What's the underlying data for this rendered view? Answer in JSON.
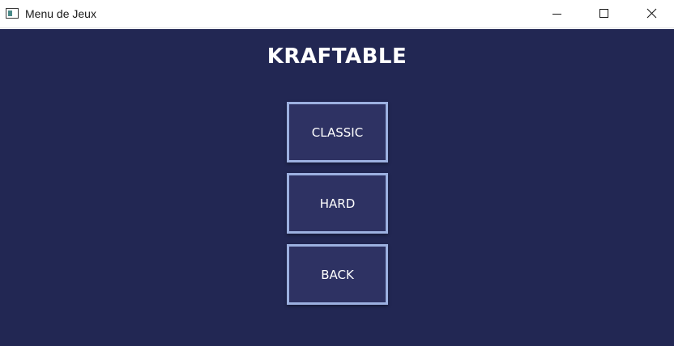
{
  "window": {
    "title": "Menu de Jeux",
    "icon": "app-window-icon",
    "controls": {
      "minimize_icon": "minimize-icon",
      "maximize_icon": "maximize-icon",
      "close_icon": "close-icon"
    }
  },
  "menu": {
    "title": "KRAFTABLE",
    "buttons": {
      "classic": "CLASSIC",
      "hard": "HARD",
      "back": "BACK"
    }
  },
  "colors": {
    "background": "#222753",
    "button_fill": "#2e3263",
    "button_border": "#9cb0e0",
    "text": "#ffffff"
  }
}
